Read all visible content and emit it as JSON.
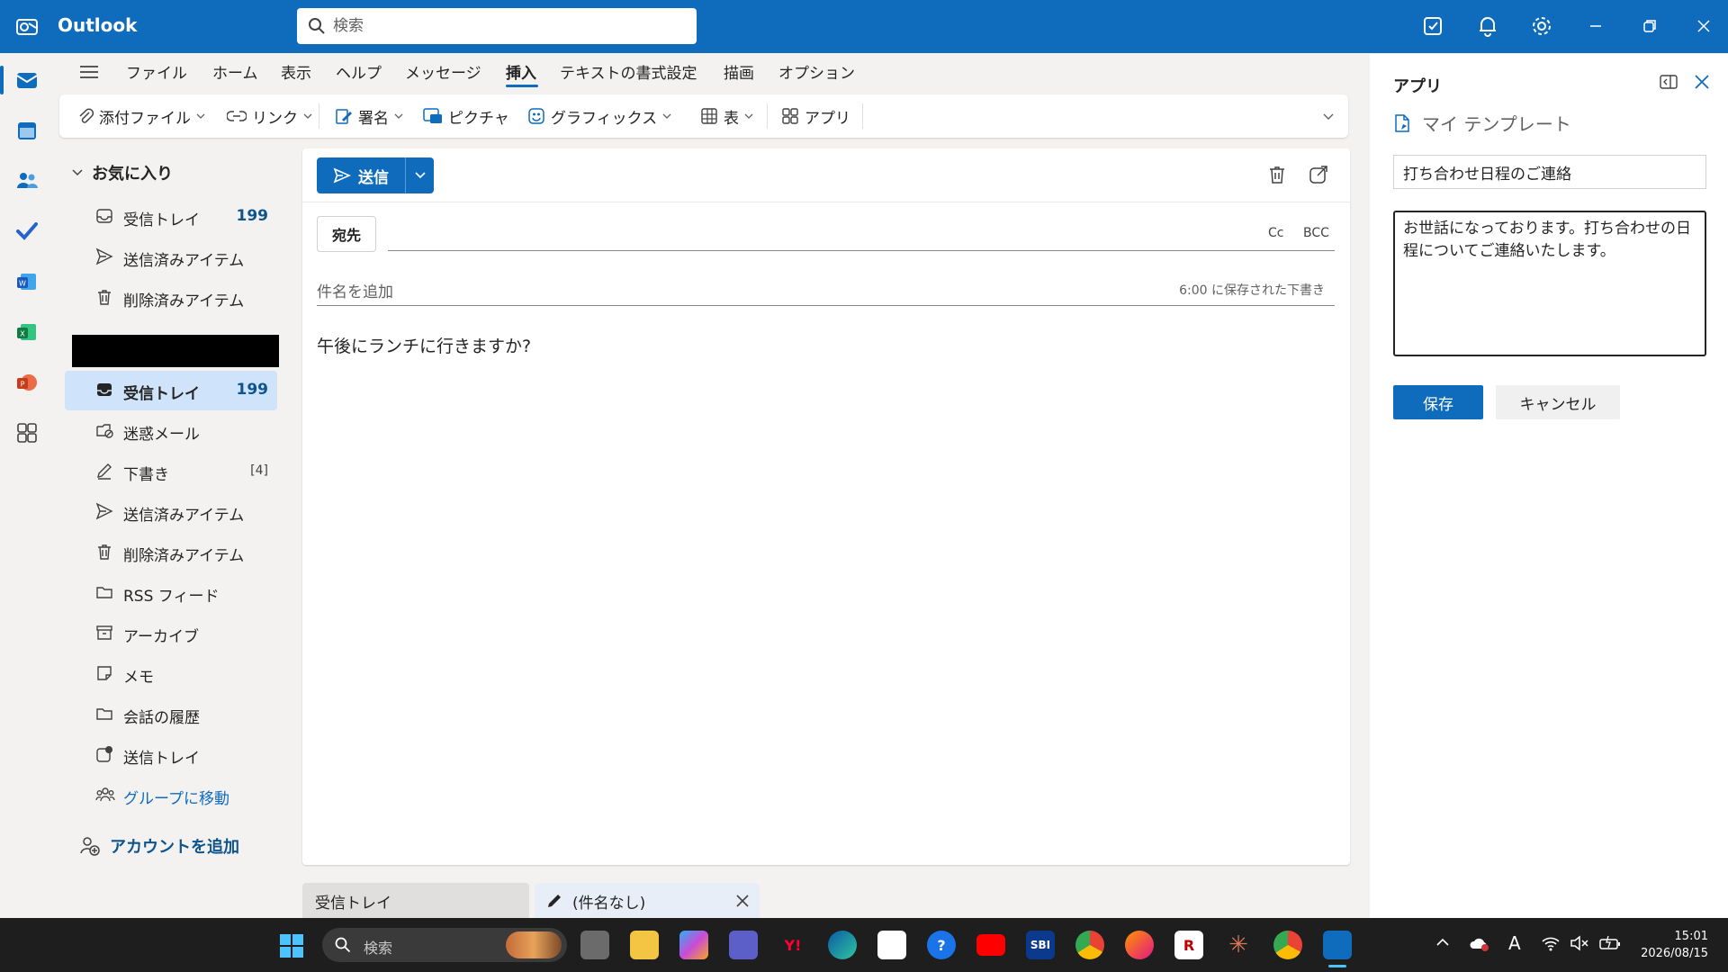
{
  "app": {
    "title": "Outlook"
  },
  "search": {
    "placeholder": "検索"
  },
  "ribbon": {
    "tabs": [
      {
        "label": "ファイル"
      },
      {
        "label": "ホーム"
      },
      {
        "label": "表示"
      },
      {
        "label": "ヘルプ"
      },
      {
        "label": "メッセージ"
      },
      {
        "label": "挿入",
        "active": true
      },
      {
        "label": "テキストの書式設定"
      },
      {
        "label": "描画"
      },
      {
        "label": "オプション"
      }
    ],
    "tools": {
      "attach": "添付ファイル",
      "link": "リンク",
      "signature": "署名",
      "picture": "ピクチャ",
      "graphics": "グラフィックス",
      "table": "表",
      "apps": "アプリ"
    }
  },
  "folders": {
    "favorites_header": "お気に入り",
    "favorites": [
      {
        "label": "受信トレイ",
        "count": "199",
        "icon": "inbox-icon"
      },
      {
        "label": "送信済みアイテム",
        "icon": "send-icon"
      },
      {
        "label": "削除済みアイテム",
        "icon": "trash-icon"
      }
    ],
    "mailbox": [
      {
        "label": "受信トレイ",
        "count": "199",
        "icon": "inbox-icon",
        "selected": true
      },
      {
        "label": "迷惑メール",
        "icon": "junk-icon"
      },
      {
        "label": "下書き",
        "count": "[4]",
        "icon": "draft-icon"
      },
      {
        "label": "送信済みアイテム",
        "icon": "send-icon"
      },
      {
        "label": "削除済みアイテム",
        "icon": "trash-icon"
      },
      {
        "label": "RSS フィード",
        "icon": "folder-icon"
      },
      {
        "label": "アーカイブ",
        "icon": "archive-icon"
      },
      {
        "label": "メモ",
        "icon": "note-icon"
      },
      {
        "label": "会話の履歴",
        "icon": "folder-icon"
      },
      {
        "label": "送信トレイ",
        "icon": "outbox-icon"
      },
      {
        "label": "グループに移動",
        "icon": "group-icon",
        "link": true
      }
    ],
    "add_account": "アカウントを追加"
  },
  "compose": {
    "send_label": "送信",
    "to_label": "宛先",
    "cc_label": "Cc",
    "bcc_label": "BCC",
    "subject_placeholder": "件名を追加",
    "saved_status": "6:00 に保存された下書き",
    "body": "午後にランチに行きますか?"
  },
  "draft_tabs": {
    "inbox": "受信トレイ",
    "current": "(件名なし)"
  },
  "apps_pane": {
    "title": "アプリ",
    "template_header": "マイ テンプレート",
    "template_title": "打ち合わせ日程のご連絡",
    "template_body": "お世話になっております。打ち合わせの日程についてご連絡いたします。",
    "save_label": "保存",
    "cancel_label": "キャンセル"
  },
  "taskbar": {
    "search_label": "検索",
    "time": "15:01",
    "date": "2026/08/15",
    "ime": "A"
  },
  "colors": {
    "brand": "#0f6cbd",
    "selected": "#cfe4fa",
    "taskbar": "#1e1e1e"
  }
}
